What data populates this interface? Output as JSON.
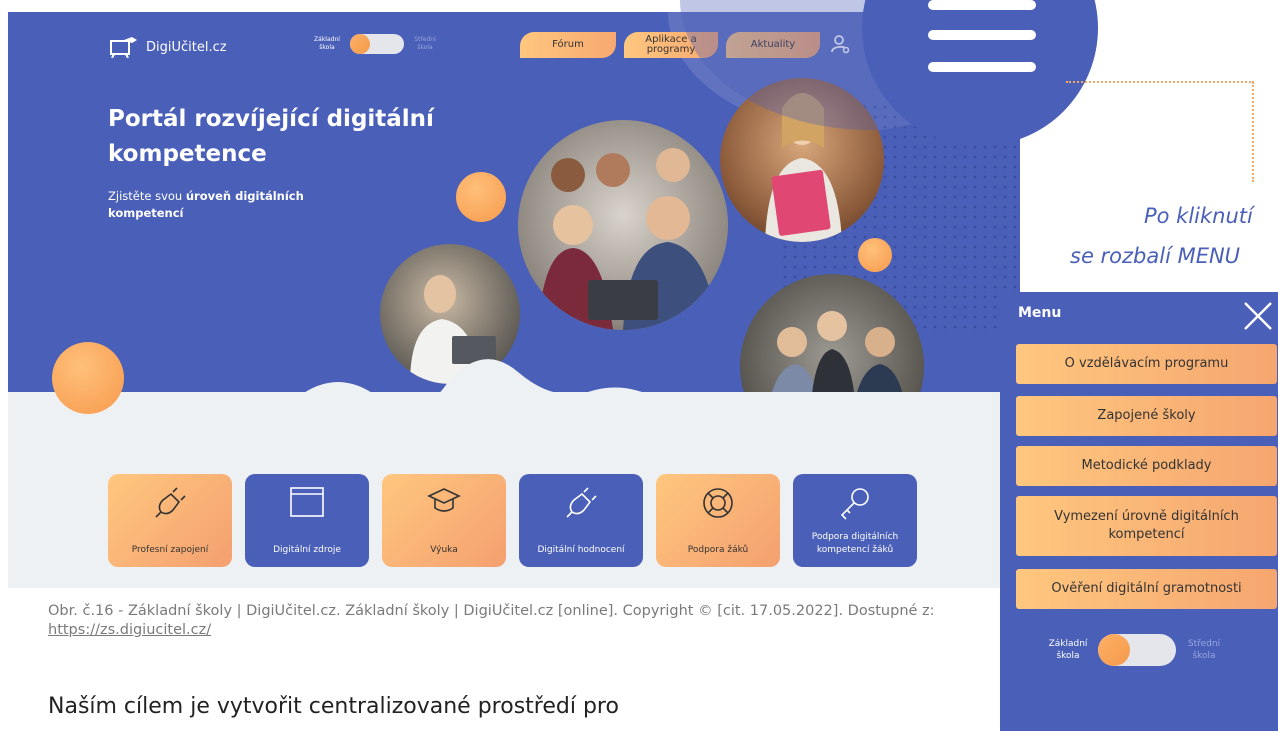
{
  "site": {
    "logo_text": "DigiUčitel.cz",
    "toggle": {
      "left_label": "Základní škola",
      "right_label": "Střední škola"
    },
    "nav": [
      {
        "label": "Fórum"
      },
      {
        "label": "Aplikace a programy"
      },
      {
        "label": "Aktuality"
      }
    ],
    "icons": [
      "user-key-icon",
      "search-icon",
      "hamburger-icon"
    ],
    "hero": {
      "title": "Portál rozvíjející digitální kompetence",
      "subtitle_prefix": "Zjistěte svou ",
      "subtitle_bold": "úroveň digitálních kompetencí"
    },
    "tiles": [
      {
        "label": "Profesní zapojení",
        "style": "orange",
        "icon": "plug-icon"
      },
      {
        "label": "Digitální zdroje",
        "style": "blue",
        "icon": "browser-window-icon"
      },
      {
        "label": "Výuka",
        "style": "orange",
        "icon": "graduation-cap-icon"
      },
      {
        "label": "Digitální hodnocení",
        "style": "blue",
        "icon": "plug-icon"
      },
      {
        "label": "Podpora žáků",
        "style": "orange",
        "icon": "lifebuoy-icon"
      },
      {
        "label": "Podpora digitálních kompetencí žáků",
        "style": "blue",
        "icon": "key-icon"
      }
    ]
  },
  "callout": {
    "line1": "Po kliknutí",
    "line2": "se rozbalí MENU"
  },
  "menu": {
    "title": "Menu",
    "items": [
      "O vzdělávacím programu",
      "Zapojené školy",
      "Metodické podklady",
      "Vymezení úrovně digitálních kompetencí",
      "Ověření digitální gramotnosti"
    ],
    "toggle": {
      "left_label": "Základní škola",
      "right_label": "Střední škola"
    }
  },
  "caption": {
    "text": "Obr. č.16 - Základní školy | DigiUčitel.cz. Základní školy | DigiUčitel.cz [online]. Copyright © [cit. 17.05.2022]. Dostupné z: ",
    "link": "https://zs.digiucitel.cz/"
  },
  "paragraph": "Naším cílem je vytvořit centralizované prostředí pro",
  "colors": {
    "brand_blue": "#4a5fb8",
    "accent_orange": "#f7a870",
    "callout_text": "#4a5fb8"
  }
}
